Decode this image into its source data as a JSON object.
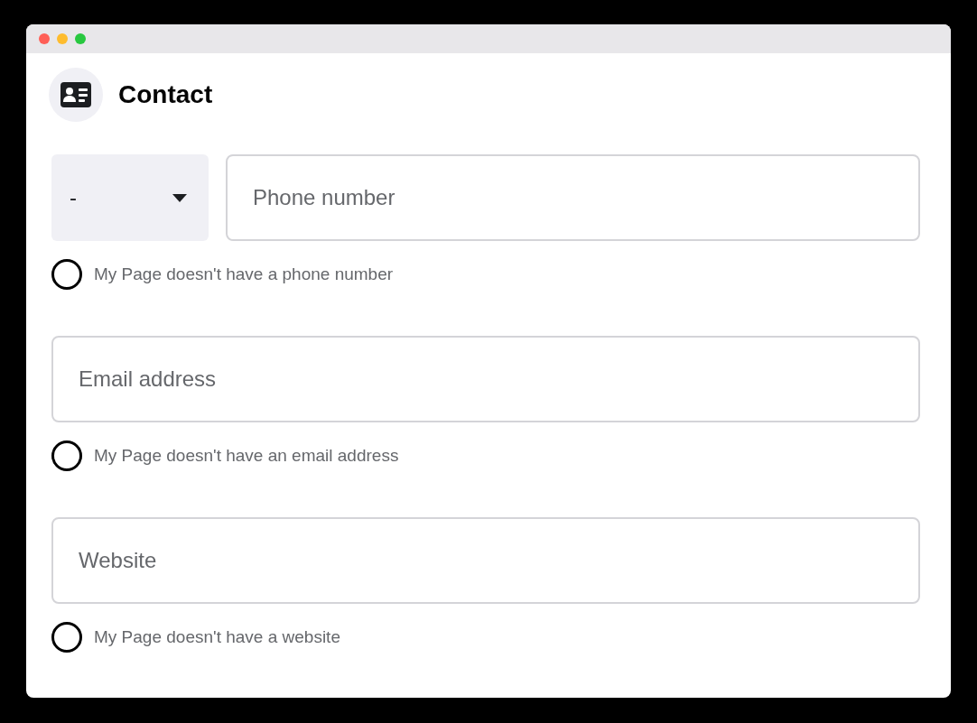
{
  "header": {
    "title": "Contact"
  },
  "sections": [
    {
      "kind": "phone",
      "country_code": "-",
      "placeholder": "Phone number",
      "option": {
        "label": "My Page doesn't have a phone number",
        "checked": false
      }
    },
    {
      "kind": "text",
      "placeholder": "Email address",
      "option": {
        "label": "My Page doesn't have an email address",
        "checked": false
      }
    },
    {
      "kind": "text",
      "placeholder": "Website",
      "option": {
        "label": "My Page doesn't have a website",
        "checked": false
      }
    }
  ]
}
